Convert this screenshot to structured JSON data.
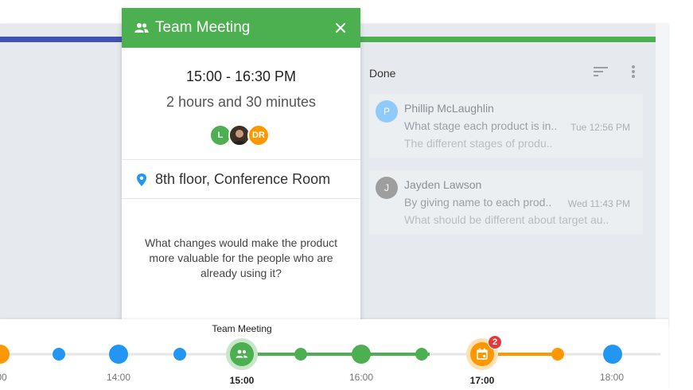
{
  "popup": {
    "title": "Team Meeting",
    "time_range": "15:00 - 16:30 PM",
    "duration": "2 hours and 30 minutes",
    "attendees": [
      {
        "initials": "L",
        "color": "#4caf50"
      },
      {
        "initials": "",
        "color": "#5d4037"
      },
      {
        "initials": "DR",
        "color": "#ff9800"
      }
    ],
    "location": "8th floor, Conference Room",
    "question": "What changes would make the product more valuable for the people who are already using it?",
    "header_color": "#4caf50"
  },
  "done_column": {
    "title": "Done",
    "cards": [
      {
        "avatar_letter": "P",
        "avatar_color": "#90caf9",
        "name": "Phillip McLaughlin",
        "line1": "What stage each product is in..",
        "time": "Tue 12:56 PM",
        "line2": "The different stages of produ.."
      },
      {
        "avatar_letter": "J",
        "avatar_color": "#9e9e9e",
        "name": "Jayden Lawson",
        "line1": "By giving name to each prod..",
        "time": "Wed 11:43 PM",
        "line2": "What should be different about target au.."
      }
    ]
  },
  "timeline": {
    "event_title": "Team Meeting",
    "labels": [
      "00",
      "14:00",
      "15:00",
      "16:00",
      "17:00",
      "18:00"
    ],
    "active_labels": [
      "15:00",
      "17:00"
    ],
    "badge_count": "2",
    "colors": {
      "blue": "#2196f3",
      "green": "#4caf50",
      "orange": "#ff9800",
      "track": "#e6e6e6"
    }
  },
  "colors": {
    "lane_blue": "#3f51b5",
    "lane_green": "#4caf50"
  }
}
